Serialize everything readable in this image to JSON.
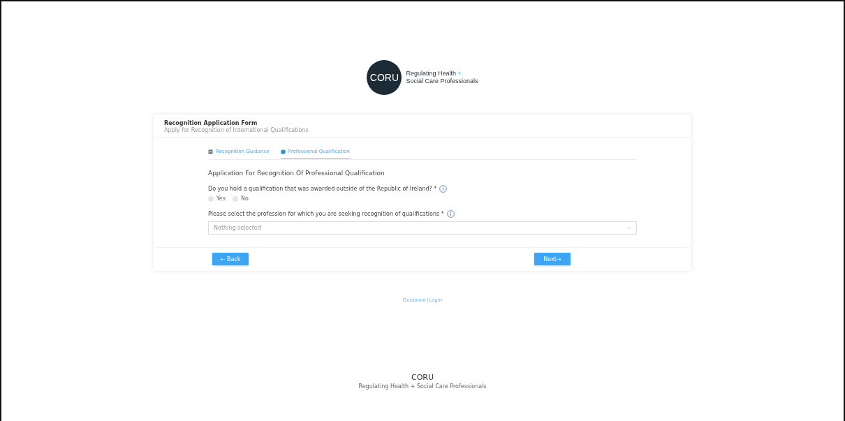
{
  "logo": {
    "mark": "CORU",
    "line1": "Regulating Health",
    "plus": "+",
    "line2": "Social Care Professionals"
  },
  "card": {
    "title": "Recognition Application Form",
    "subtitle": "Apply for Recognition of International Qualifications",
    "tabs": [
      {
        "label": "Recognition Guidance",
        "kind": "book",
        "selected": false
      },
      {
        "label": "Professional Qualification",
        "kind": "dot",
        "selected": true
      }
    ],
    "heading": "Application For Recognition Of Professional Qualification",
    "question1": {
      "label": "Do you hold a qualification that was awarded outside of the Republic of Ireland? *",
      "options": [
        {
          "label": "Yes",
          "selected": false
        },
        {
          "label": "No",
          "selected": false
        }
      ]
    },
    "question2": {
      "label": "Please select the profession for which you are seeking recognition of qualifications *",
      "placeholder": "Nothing selected"
    },
    "back": "← Back",
    "next": "Next→"
  },
  "links": [
    "Guidance",
    "|",
    "Login"
  ],
  "footer": {
    "title": "CORU",
    "subtitle": "Regulating Health + Social Care Professionals"
  }
}
